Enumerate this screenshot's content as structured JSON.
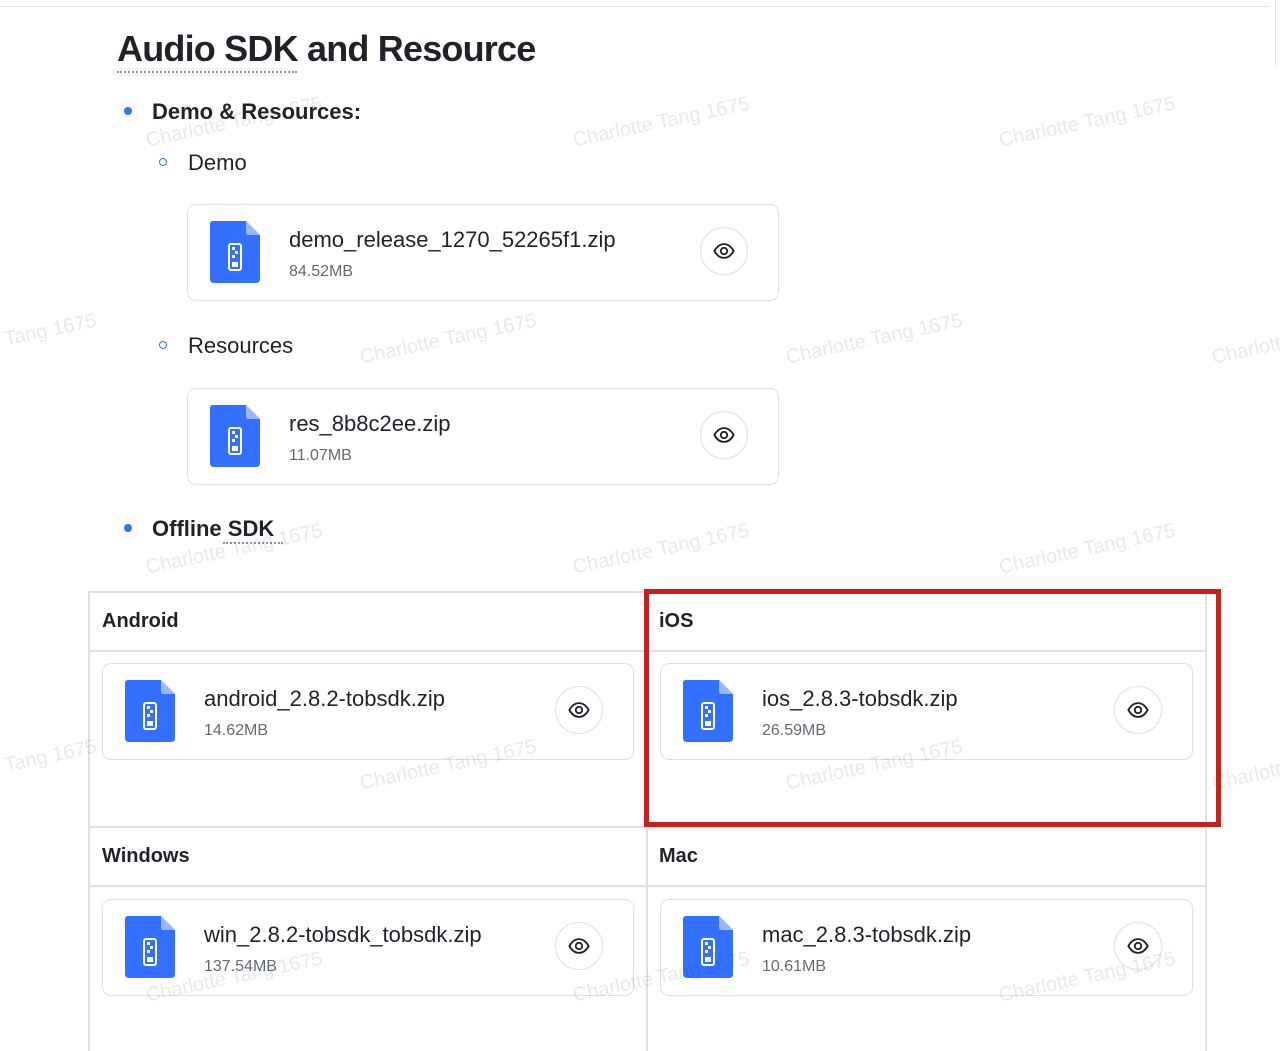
{
  "page": {
    "title": "Audio SDK and Resource"
  },
  "sections": {
    "demo_resources": {
      "heading": "Demo & Resources:",
      "demo": {
        "label": "Demo",
        "file": {
          "name": "demo_release_1270_52265f1.zip",
          "size": "84.52MB"
        }
      },
      "resources": {
        "label": "Resources",
        "file": {
          "name": "res_8b8c2ee.zip",
          "size": "11.07MB"
        }
      }
    },
    "offline_sdk": {
      "heading": "Offline SDK",
      "table": {
        "android": {
          "header": "Android",
          "file": {
            "name": "android_2.8.2-tobsdk.zip",
            "size": "14.62MB"
          }
        },
        "ios": {
          "header": "iOS",
          "file": {
            "name": "ios_2.8.3-tobsdk.zip",
            "size": "26.59MB"
          }
        },
        "windows": {
          "header": "Windows",
          "file": {
            "name": "win_2.8.2-tobsdk_tobsdk.zip",
            "size": "137.54MB"
          }
        },
        "mac": {
          "header": "Mac",
          "file": {
            "name": "mac_2.8.3-tobsdk.zip",
            "size": "10.61MB"
          }
        }
      }
    }
  },
  "watermark": {
    "text": "Charlotte Tang 1675"
  },
  "icons": {
    "file": "zip-file-icon",
    "preview": "eye-icon"
  },
  "colors": {
    "accent": "#3370ff",
    "highlight": "#c4221a",
    "border": "#dee0e3"
  }
}
